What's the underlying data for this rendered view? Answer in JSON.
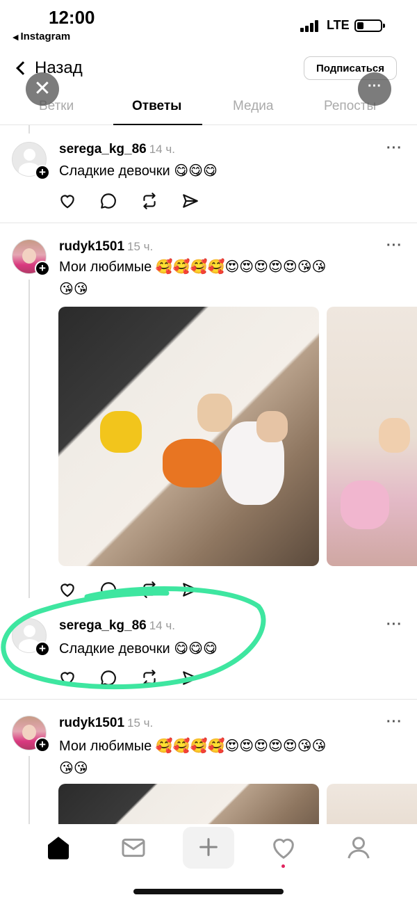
{
  "status_bar": {
    "time": "12:00",
    "back_app": "Instagram",
    "network": "LTE"
  },
  "header": {
    "back_label": "Назад",
    "subscribe_label": "Подписаться",
    "tabs": [
      {
        "label": "Ветки",
        "active": false
      },
      {
        "label": "Ответы",
        "active": true
      },
      {
        "label": "Медиа",
        "active": false
      },
      {
        "label": "Репосты",
        "active": false
      }
    ]
  },
  "posts": [
    {
      "username": "serega_kg_86",
      "time": "14 ч.",
      "text": "Сладкие девочки",
      "emoji": "😋😋😋",
      "avatar": "default-avatar"
    },
    {
      "username": "rudyk1501",
      "time": "15 ч.",
      "text": "Мои любимые",
      "emoji": "🥰🥰🥰🥰😍😍😍😍😍😘😘",
      "emoji2": "😘😘",
      "avatar": "photo-avatar"
    },
    {
      "username": "serega_kg_86",
      "time": "14 ч.",
      "text": "Сладкие девочки",
      "emoji": "😋😋😋",
      "avatar": "default-avatar"
    },
    {
      "username": "rudyk1501",
      "time": "15 ч.",
      "text": "Мои любимые",
      "emoji": "🥰🥰🥰🥰😍😍😍😍😍😘😘",
      "emoji2": "😘😘",
      "avatar": "photo-avatar"
    }
  ],
  "icons": {
    "like": "heart-icon",
    "reply": "comment-icon",
    "repost": "repost-icon",
    "share": "send-icon",
    "more": "more-dots-icon"
  },
  "tab_bar": [
    "home-icon",
    "inbox-icon",
    "create-icon",
    "activity-icon",
    "profile-icon"
  ],
  "colors": {
    "annotation": "#3ee6a0",
    "notification_dot": "#e0245e"
  }
}
